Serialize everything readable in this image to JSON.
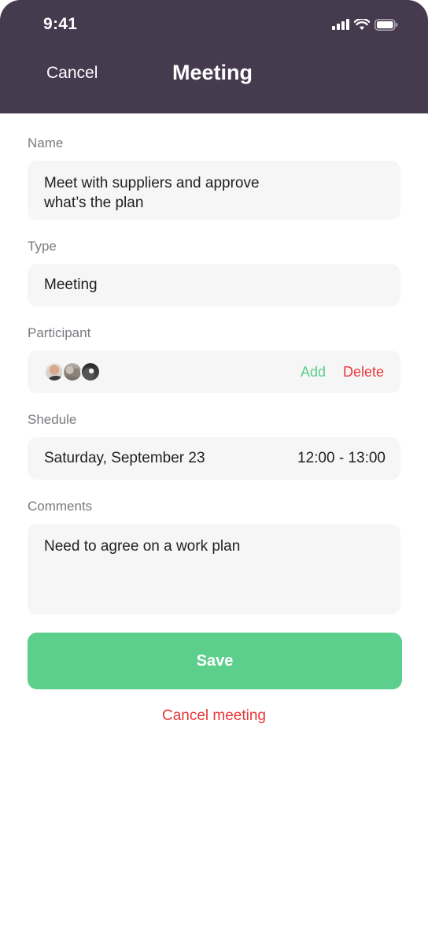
{
  "status_bar": {
    "time": "9:41",
    "icons": [
      "signal-icon",
      "wifi-icon",
      "battery-icon"
    ]
  },
  "header": {
    "cancel_label": "Cancel",
    "title": "Meeting",
    "background": "#463a4f"
  },
  "form": {
    "name": {
      "label": "Name",
      "value_line1": "Meet with suppliers and approve",
      "value_line2": "what’s the plan"
    },
    "type": {
      "label": "Type",
      "value": "Meeting"
    },
    "participant": {
      "label": "Participant",
      "avatars": [
        "avatar-1",
        "avatar-2",
        "avatar-3"
      ],
      "add_label": "Add",
      "delete_label": "Delete"
    },
    "schedule": {
      "label": "Shedule",
      "date": "Saturday, September 23",
      "time": "12:00 - 13:00"
    },
    "comments": {
      "label": "Comments",
      "value": "Need to agree on a work plan"
    }
  },
  "actions": {
    "save_label": "Save",
    "cancel_meeting_label": "Cancel meeting"
  },
  "colors": {
    "accent_green": "#5dcf8c",
    "danger_red": "#e8383b",
    "field_bg": "#f6f6f6"
  }
}
